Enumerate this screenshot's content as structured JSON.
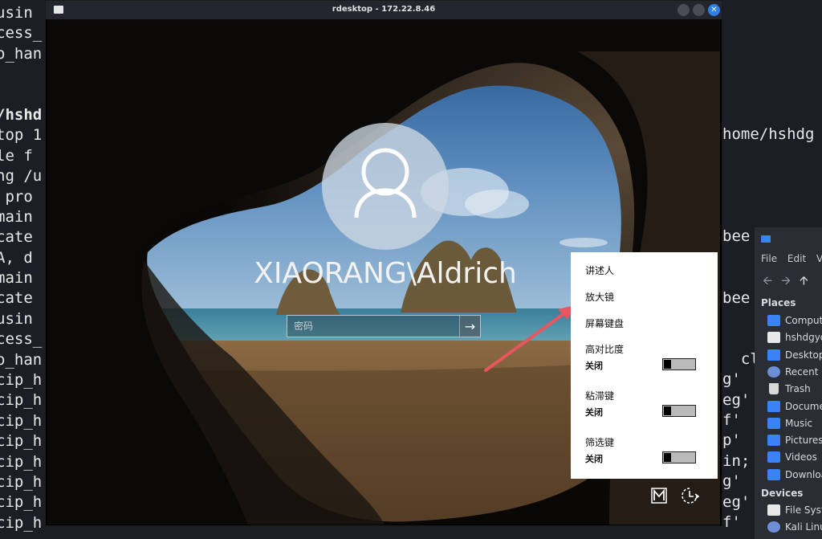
{
  "terminal": {
    "left_lines": [
      "usin",
      "cess_",
      "o_han",
      "",
      "",
      "/hshd",
      "top 1",
      "le f",
      "ng /u",
      " pro",
      "main",
      "cate",
      "A, d",
      "main",
      "cate",
      "usin",
      "cess_",
      "o_han",
      "cip_h",
      "cip_h",
      "cip_h",
      "cip_h",
      "cip_h",
      "cip_h",
      "cip_h",
      "cip_h"
    ],
    "right_fragments": [
      {
        "text": "home/hshdg",
        "row": 6
      },
      {
        "text": "bee",
        "row": 11
      },
      {
        "text": "bee",
        "row": 14
      },
      {
        "text": "  cl",
        "row": 17
      },
      {
        "text": "g'",
        "row": 18
      },
      {
        "text": "eg'",
        "row": 19
      },
      {
        "text": "f'",
        "row": 20
      },
      {
        "text": "p'",
        "row": 21
      },
      {
        "text": "in;",
        "row": 22
      },
      {
        "text": "g'",
        "row": 23
      },
      {
        "text": "eg'",
        "row": 24
      },
      {
        "text": "f'",
        "row": 25
      }
    ]
  },
  "file_manager": {
    "menu": [
      "File",
      "Edit",
      "V"
    ],
    "places_label": "Places",
    "places": [
      {
        "label": "Compute",
        "icon": "computer-icon"
      },
      {
        "label": "hshdgyq",
        "icon": "home-folder-icon"
      },
      {
        "label": "Desktop",
        "icon": "desktop-icon"
      },
      {
        "label": "Recent",
        "icon": "recent-icon"
      },
      {
        "label": "Trash",
        "icon": "trash-icon"
      },
      {
        "label": "Docume",
        "icon": "documents-folder-icon"
      },
      {
        "label": "Music",
        "icon": "music-folder-icon"
      },
      {
        "label": "Pictures",
        "icon": "pictures-folder-icon"
      },
      {
        "label": "Videos",
        "icon": "videos-folder-icon"
      },
      {
        "label": "Downloa",
        "icon": "downloads-folder-icon"
      }
    ],
    "devices_label": "Devices",
    "devices": [
      {
        "label": "File Syst",
        "icon": "filesystem-icon"
      },
      {
        "label": "Kali Linu",
        "icon": "disc-icon"
      }
    ]
  },
  "window": {
    "title": "rdesktop - 172.22.8.46",
    "accent": "#2e7fe8"
  },
  "login": {
    "username": "XIAORANG\\Aldrich",
    "password_placeholder": "密码"
  },
  "ease_menu": {
    "narrator": "讲述人",
    "magnifier": "放大镜",
    "onscreen_keyboard": "屏幕键盘",
    "high_contrast": {
      "label": "高对比度",
      "state": "关闭"
    },
    "sticky_keys": {
      "label": "粘滞键",
      "state": "关闭"
    },
    "filter_keys": {
      "label": "筛选键",
      "state": "关闭"
    }
  },
  "colors": {
    "annotation_arrow": "#e8565f",
    "terminal_bg": "#1b1e25",
    "menu_bg": "#ffffff"
  }
}
